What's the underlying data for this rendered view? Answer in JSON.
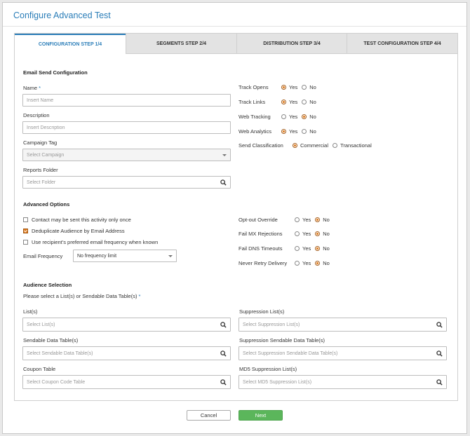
{
  "dialog": {
    "title": "Configure Advanced Test"
  },
  "tabs": [
    {
      "label": "CONFIGURATION STEP 1/4",
      "active": true
    },
    {
      "label": "SEGMENTS STEP 2/4",
      "active": false
    },
    {
      "label": "DISTRIBUTION STEP 3/4",
      "active": false
    },
    {
      "label": "TEST CONFIGURATION STEP 4/4",
      "active": false
    }
  ],
  "email_send": {
    "heading": "Email Send Configuration",
    "name_label": "Name",
    "required_mark": "*",
    "name_placeholder": "Insert Name",
    "description_label": "Description",
    "description_placeholder": "Insert Description",
    "campaign_label": "Campaign Tag",
    "campaign_placeholder": "Select Campaign",
    "reports_label": "Reports Folder",
    "reports_placeholder": "Select Folder"
  },
  "tracking": [
    {
      "label": "Track Opens",
      "options": [
        "Yes",
        "No"
      ],
      "selected": "Yes"
    },
    {
      "label": "Track Links",
      "options": [
        "Yes",
        "No"
      ],
      "selected": "Yes"
    },
    {
      "label": "Web Tracking",
      "options": [
        "Yes",
        "No"
      ],
      "selected": "No"
    },
    {
      "label": "Web Analytics",
      "options": [
        "Yes",
        "No"
      ],
      "selected": "Yes"
    },
    {
      "label": "Send Classification",
      "options": [
        "Commercial",
        "Transactional"
      ],
      "selected": "Commercial"
    }
  ],
  "advanced": {
    "heading": "Advanced Options",
    "checkboxes": [
      {
        "label": "Contact may be sent this activity only once",
        "checked": false
      },
      {
        "label": "Deduplicate Audience by Email Address",
        "checked": true
      },
      {
        "label": "Use recipient's preferred email frequency when known",
        "checked": false
      }
    ],
    "frequency_label": "Email Frequency",
    "frequency_value": "No frequency limit",
    "overrides": [
      {
        "label": "Opt-out Override",
        "options": [
          "Yes",
          "No"
        ],
        "selected": "No"
      },
      {
        "label": "Fail MX Rejections",
        "options": [
          "Yes",
          "No"
        ],
        "selected": "No"
      },
      {
        "label": "Fail DNS Timeouts",
        "options": [
          "Yes",
          "No"
        ],
        "selected": "No"
      },
      {
        "label": "Never Retry Delivery",
        "options": [
          "Yes",
          "No"
        ],
        "selected": "No"
      }
    ]
  },
  "audience": {
    "heading": "Audience Selection",
    "instruction": "Please select a List(s) or Sendable Data Table(s)",
    "required_mark": "*",
    "lists_label": "List(s)",
    "lists_placeholder": "Select List(s)",
    "sendable_label": "Sendable Data Table(s)",
    "sendable_placeholder": "Select Sendable Data Table(s)",
    "coupon_label": "Coupon Table",
    "coupon_placeholder": "Select Coupon Code Table",
    "suppression_label": "Suppression List(s)",
    "suppression_placeholder": "Select Suppression List(s)",
    "supp_sendable_label": "Suppression Sendable Data Table(s)",
    "supp_sendable_placeholder": "Select Suppression Sendable Data Table(s)",
    "md5_label": "MD5 Suppression List(s)",
    "md5_placeholder": "Select MD5 Suppression List(s)"
  },
  "footer": {
    "cancel_label": "Cancel",
    "next_label": "Next"
  },
  "colors": {
    "accent": "#2a7db8",
    "radio_on": "#e07a1a",
    "next_button": "#5bb65b"
  }
}
